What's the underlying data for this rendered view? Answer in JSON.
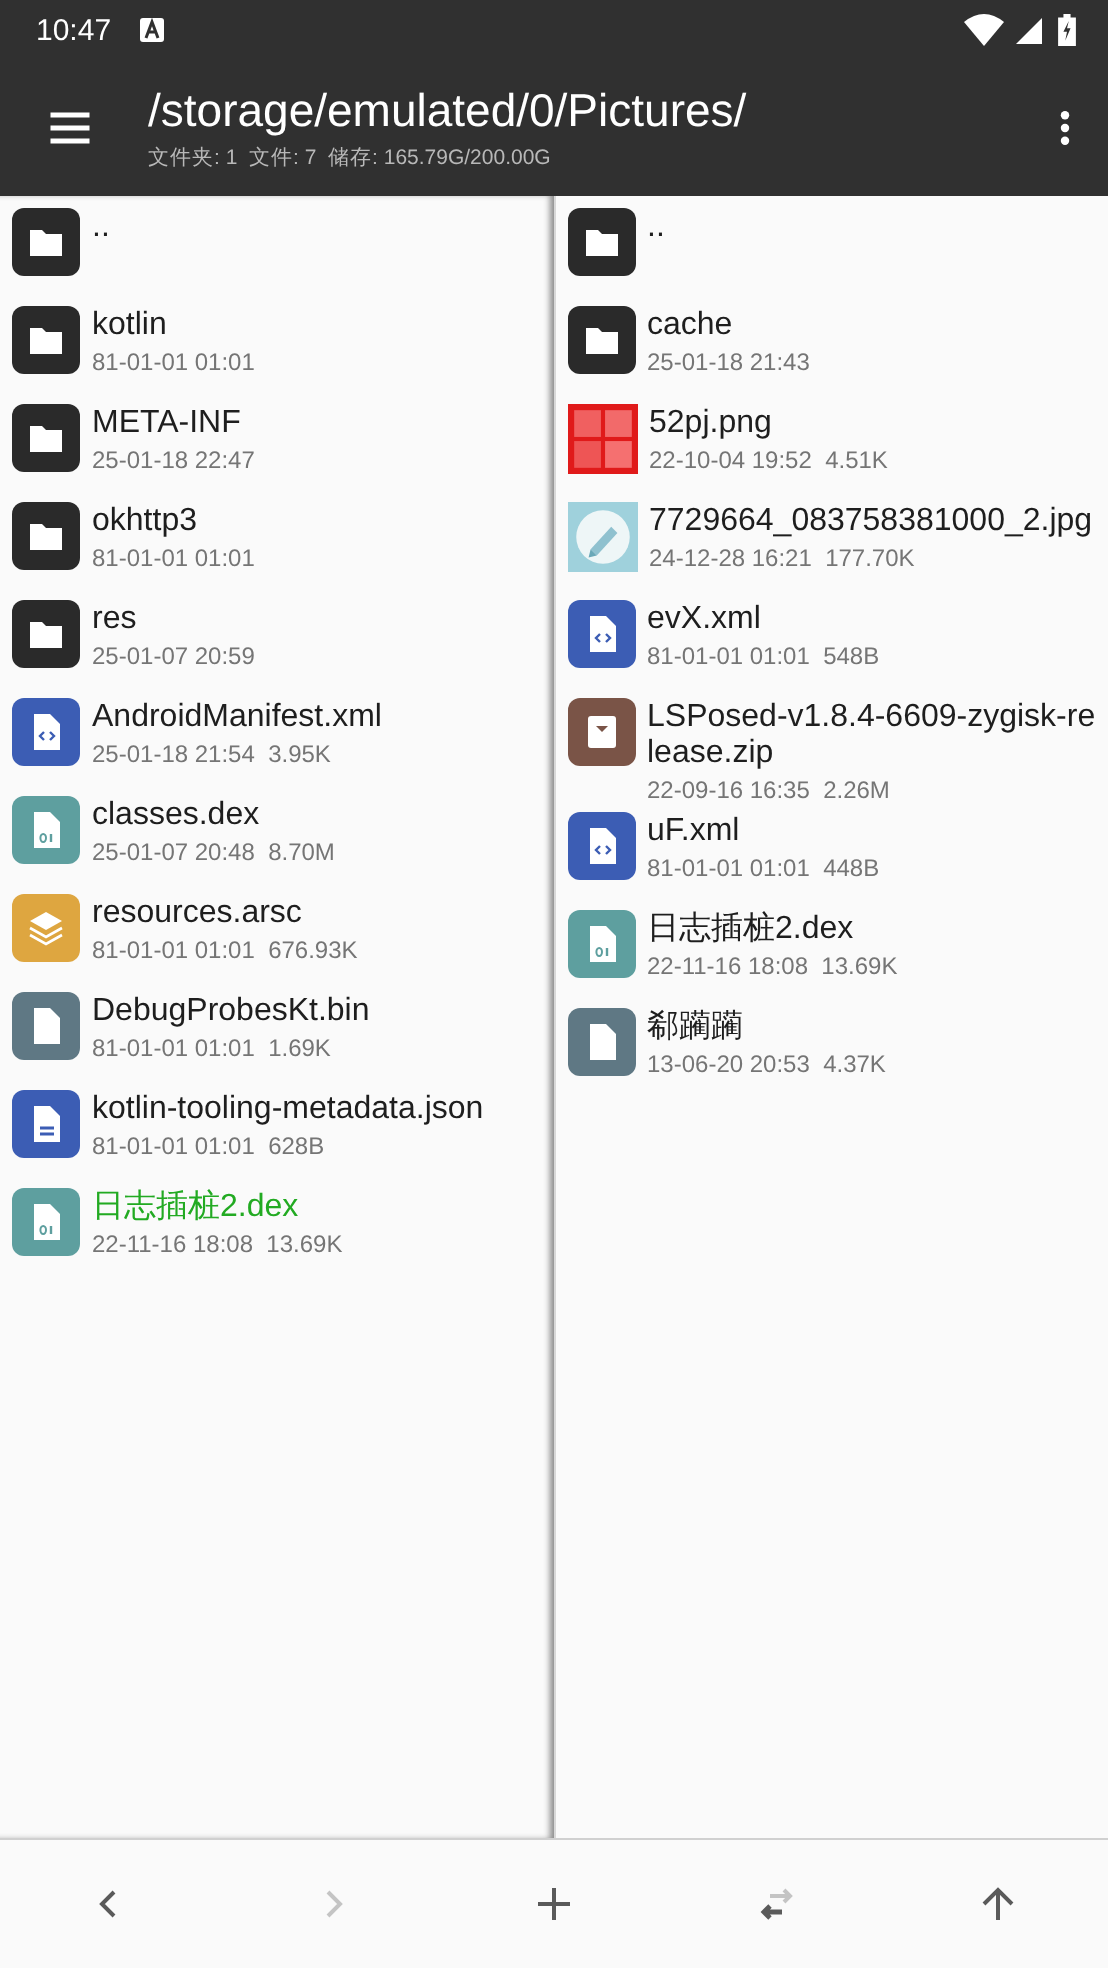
{
  "status_bar": {
    "time": "10:47"
  },
  "toolbar": {
    "path": "/storage/emulated/0/Pictures/",
    "summary": "文件夹: 1  文件: 7  储存: 165.79G/200.00G"
  },
  "panes": [
    {
      "selected": true,
      "items": [
        {
          "kind": "folder",
          "name": "..",
          "highlight": false
        },
        {
          "kind": "folder",
          "name": "kotlin",
          "meta": "81-01-01 01:01",
          "highlight": false
        },
        {
          "kind": "folder",
          "name": "META-INF",
          "meta": "25-01-18 22:47",
          "highlight": false
        },
        {
          "kind": "folder",
          "name": "okhttp3",
          "meta": "81-01-01 01:01",
          "highlight": false
        },
        {
          "kind": "folder",
          "name": "res",
          "meta": "25-01-07 20:59",
          "highlight": false
        },
        {
          "kind": "xml",
          "name": "AndroidManifest.xml",
          "meta": "25-01-18 21:54  3.95K",
          "highlight": false
        },
        {
          "kind": "dex",
          "name": "classes.dex",
          "meta": "25-01-07 20:48  8.70M",
          "highlight": false
        },
        {
          "kind": "arsc",
          "name": "resources.arsc",
          "meta": "81-01-01 01:01  676.93K",
          "highlight": false
        },
        {
          "kind": "bin",
          "name": "DebugProbesKt.bin",
          "meta": "81-01-01 01:01  1.69K",
          "highlight": false
        },
        {
          "kind": "json",
          "name": "kotlin-tooling-metadata.json",
          "meta": "81-01-01 01:01  628B",
          "highlight": false
        },
        {
          "kind": "dex",
          "name": "日志插桩2.dex",
          "meta": "22-11-16 18:08  13.69K",
          "highlight": true
        }
      ]
    },
    {
      "selected": false,
      "items": [
        {
          "kind": "folder",
          "name": "..",
          "highlight": false
        },
        {
          "kind": "folder",
          "name": "cache",
          "meta": "25-01-18 21:43",
          "highlight": false
        },
        {
          "kind": "picture",
          "name": "52pj.png",
          "meta": "22-10-04 19:52  4.51K",
          "highlight": false
        },
        {
          "kind": "picture",
          "name": "7729664_083758381000_2.jpg",
          "meta": "24-12-28 16:21  177.70K",
          "highlight": false
        },
        {
          "kind": "xml",
          "name": "evX.xml",
          "meta": "81-01-01 01:01  548B",
          "highlight": false
        },
        {
          "kind": "zip",
          "name": "LSPosed-v1.8.4-6609-zygisk-release.zip",
          "meta": "22-09-16 16:35  2.26M",
          "highlight": false
        },
        {
          "kind": "xml",
          "name": "uF.xml",
          "meta": "81-01-01 01:01  448B",
          "highlight": false
        },
        {
          "kind": "dex",
          "name": "日志插桩2.dex",
          "meta": "22-11-16 18:08  13.69K",
          "highlight": false
        },
        {
          "kind": "bin",
          "name": "郗躏躏",
          "meta": "13-06-20 20:53  4.37K",
          "highlight": false
        }
      ]
    }
  ],
  "bottom_bar": [
    {
      "kind": "back",
      "disabled": false
    },
    {
      "kind": "forward",
      "disabled": true
    },
    {
      "kind": "add",
      "disabled": false
    },
    {
      "kind": "swap",
      "disabled": false
    },
    {
      "kind": "up",
      "disabled": false
    }
  ]
}
